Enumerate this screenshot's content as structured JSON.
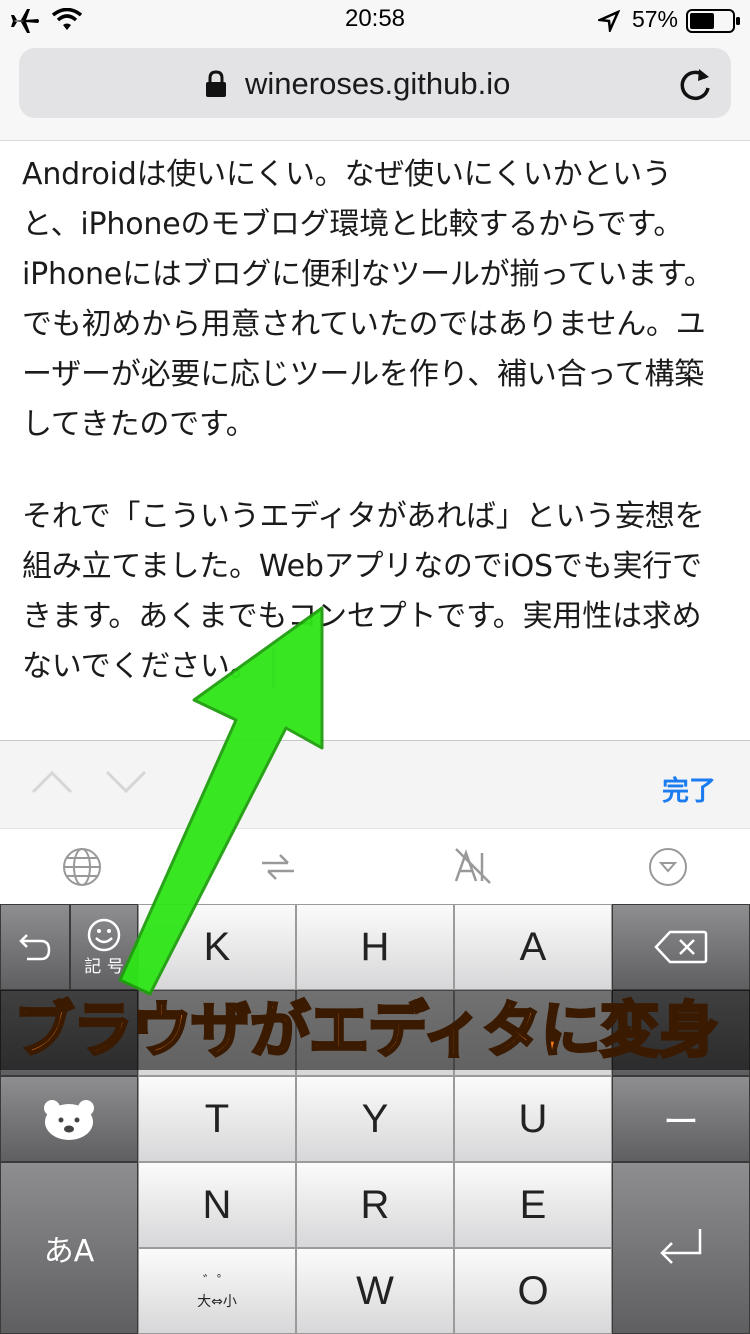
{
  "status_bar": {
    "time": "20:58",
    "battery_percent": "57%"
  },
  "browser": {
    "url": "wineroses.github.io"
  },
  "editor": {
    "paragraphs": [
      "Androidは使いにくい。なぜ使いにくいかというと、iPhoneのモブログ環境と比較するからです。iPhoneにはブログに便利なツールが揃っています。でも初めから用意されていたのではありません。ユーザーが必要に応じツールを作り、補い合って構築してきたのです。",
      "それで「こういうエディタがあれば」という妄想を組み立てました。WebアプリなのでiOSでも実行できます。あくまでもコンセプトです。実用性は求めないでください。"
    ]
  },
  "accessory_bar": {
    "done_label": "完了"
  },
  "keyboard": {
    "keys": {
      "k": "K",
      "h": "H",
      "a": "A",
      "t": "T",
      "y": "Y",
      "u": "U",
      "n": "N",
      "r": "R",
      "e": "E",
      "w": "W",
      "o": "O"
    },
    "symbols_label": "記 号",
    "mode_label": "あA",
    "dash_label": "ー",
    "dakuten_label": "゛゜",
    "size_label": "大⇔小"
  },
  "overlay": {
    "caption": "ブラウザがエディタに変身"
  },
  "colors": {
    "accent": "#1a7cf0",
    "caption": "#ff7f14",
    "arrow": "#2ee617"
  }
}
